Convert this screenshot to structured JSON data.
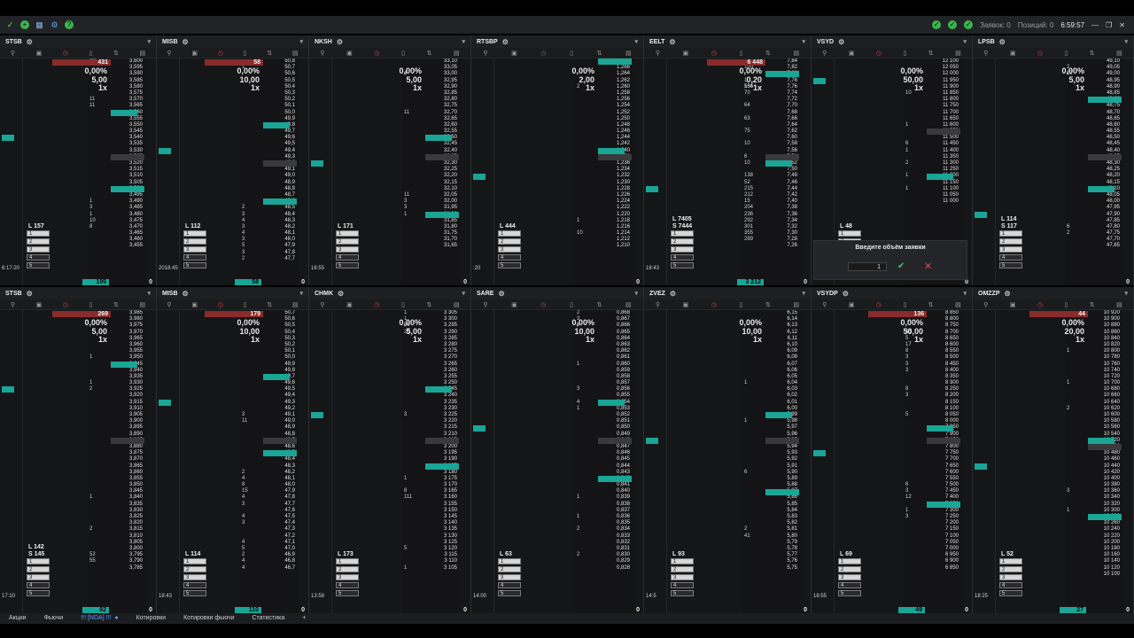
{
  "app": {
    "time": "6:59:57",
    "status_orders": "Заявок: 0",
    "status_positions": "Позиций: 0"
  },
  "popup": {
    "title": "Введите объём заявки",
    "value": "1"
  },
  "statusbar": {
    "tabs": [
      "Акции",
      "Фьючи",
      "!!! [NDA] !!!",
      "Котировки",
      "Котировки фьючи",
      "Статистика"
    ],
    "active_index": 2,
    "add_label": "+"
  },
  "panels_top": [
    {
      "ticker": "STSB",
      "badge": "431",
      "pct": "0,00%",
      "step": "5,00",
      "mult": "1x",
      "l": "L 157",
      "s": "",
      "bot": "195",
      "prices": [
        "3,600",
        "3,595",
        "3,590",
        "3,585",
        "3,580",
        "3,575",
        "3,570",
        "3,565",
        "3,560",
        "3,555",
        "3,550",
        "3,545",
        "3,540",
        "3,535",
        "3,530",
        "3,525",
        "3,520",
        "3,515",
        "3,510",
        "3,505",
        "3,500",
        "3,495",
        "3,490",
        "3,485",
        "3,480",
        "3,475",
        "3,470",
        "3,465",
        "3,460",
        "3,455"
      ],
      "vols": [
        "23",
        "",
        "",
        "",
        "",
        "",
        "11",
        "11",
        "",
        "",
        "",
        "",
        "",
        "",
        "",
        "",
        "",
        "",
        "",
        "",
        "",
        "",
        "1",
        "3",
        "1",
        "10",
        "8",
        "",
        "",
        ""
      ],
      "time": "6:17:20"
    },
    {
      "ticker": "MISB",
      "badge": "58",
      "pct": "0,00%",
      "step": "10,00",
      "mult": "1x",
      "l": "L 112",
      "s": "",
      "bot": "58",
      "prices": [
        "50,8",
        "50,7",
        "50,6",
        "50,5",
        "50,4",
        "50,3",
        "50,2",
        "50,1",
        "50,0",
        "49,9",
        "49,8",
        "49,7",
        "49,6",
        "49,5",
        "49,4",
        "49,3",
        "49,2",
        "49,1",
        "49,0",
        "48,9",
        "48,8",
        "48,7",
        "48,6",
        "48,5",
        "48,4",
        "48,3",
        "48,2",
        "48,1",
        "48,0",
        "47,9",
        "47,8",
        "47,7"
      ],
      "vols": [
        "",
        "1",
        "",
        "",
        "",
        "",
        "",
        "",
        "",
        "",
        "",
        "",
        "",
        "",
        "",
        "",
        "",
        "",
        "",
        "",
        "",
        "",
        "",
        "2",
        "3",
        "4",
        "3",
        "4",
        "3",
        "5",
        "3",
        "2"
      ],
      "time": "2018:45"
    },
    {
      "ticker": "NKSH",
      "badge": "",
      "pct": "0,00%",
      "step": "5,00",
      "mult": "1x",
      "l": "L 171",
      "s": "",
      "bot": "",
      "prices": [
        "33,10",
        "33,05",
        "33,00",
        "32,95",
        "32,90",
        "32,85",
        "32,80",
        "32,75",
        "32,70",
        "32,65",
        "32,60",
        "32,55",
        "32,50",
        "32,45",
        "32,40",
        "32,35",
        "32,30",
        "32,25",
        "32,20",
        "32,15",
        "32,10",
        "32,05",
        "32,00",
        "31,95",
        "31,90",
        "31,85",
        "31,80",
        "31,75",
        "31,70",
        "31,65"
      ],
      "vols": [
        "",
        "",
        "4",
        "",
        "",
        "",
        "",
        "",
        "11",
        "",
        "",
        "",
        "",
        "",
        "",
        "",
        "",
        "",
        "",
        "",
        "",
        "11",
        "3",
        "3",
        "1",
        "",
        "",
        "",
        "",
        ""
      ],
      "time": "18:55"
    },
    {
      "ticker": "RTSBP",
      "badge": "",
      "pct": "0,00%",
      "step": "2,00",
      "mult": "1x",
      "l": "L 444",
      "s": "",
      "bot": "",
      "prices": [
        "1,268",
        "1,266",
        "1,264",
        "1,262",
        "1,260",
        "1,258",
        "1,256",
        "1,254",
        "1,252",
        "1,250",
        "1,248",
        "1,246",
        "1,244",
        "1,242",
        "1,240",
        "1,238",
        "1,236",
        "1,234",
        "1,232",
        "1,230",
        "1,228",
        "1,226",
        "1,224",
        "1,222",
        "1,220",
        "1,218",
        "1,216",
        "1,214",
        "1,212",
        "1,210"
      ],
      "vols": [
        "",
        "",
        "",
        "",
        "2",
        "",
        "",
        "",
        "",
        "",
        "",
        "",
        "",
        "",
        "",
        "",
        "",
        "",
        "",
        "",
        "",
        "",
        "",
        "",
        "",
        "1",
        "",
        "10",
        "",
        ""
      ],
      "time": ":20"
    },
    {
      "ticker": "EELT",
      "badge": "6 448",
      "pct": "0,00%",
      "step": "0,20",
      "mult": "1x",
      "l": "L 7405",
      "s": "S 7444",
      "bot": "3 212",
      "prices": [
        "7,84",
        "7,82",
        "7,80",
        "7,78",
        "7,76",
        "7,74",
        "7,72",
        "7,70",
        "7,68",
        "7,66",
        "7,64",
        "7,62",
        "7,60",
        "7,58",
        "7,56",
        "7,54",
        "7,52",
        "7,50",
        "7,48",
        "7,46",
        "7,44",
        "7,42",
        "7,40",
        "7,38",
        "7,36",
        "7,34",
        "7,32",
        "7,30",
        "7,28",
        "7,26"
      ],
      "vols": [
        "",
        "100",
        "",
        "1 554",
        "136",
        "70",
        "",
        "64",
        "",
        "63",
        "",
        "75",
        "",
        "10",
        "",
        "6",
        "10",
        "",
        "138",
        "52",
        "215",
        "212",
        "15",
        "204",
        "236",
        "292",
        "301",
        "355",
        "289",
        ""
      ],
      "time": "18:43"
    },
    {
      "ticker": "VSYD",
      "badge": "",
      "pct": "0,00%",
      "step": "50,00",
      "mult": "1x",
      "l": "L 48",
      "s": "",
      "bot": "",
      "prices": [
        "12 100",
        "12 050",
        "12 000",
        "11 950",
        "11 900",
        "11 850",
        "11 800",
        "11 750",
        "11 700",
        "11 650",
        "11 600",
        "11 550",
        "11 500",
        "11 450",
        "11 400",
        "11 350",
        "11 300",
        "11 250",
        "11 200",
        "11 150",
        "11 100",
        "11 050",
        "11 000"
      ],
      "vols": [
        "",
        "",
        "",
        "",
        "",
        "10",
        "",
        "",
        "",
        "",
        "1",
        "",
        "",
        "6",
        "1",
        "",
        "2",
        "",
        "1",
        "",
        "1",
        "",
        ""
      ],
      "time": ""
    },
    {
      "ticker": "LPSB",
      "badge": "",
      "pct": "0,00%",
      "step": "5,00",
      "mult": "1x",
      "l": "L 114",
      "s": "S 117",
      "bot": "",
      "prices": [
        "49,10",
        "49,05",
        "49,00",
        "48,95",
        "48,90",
        "48,85",
        "48,80",
        "48,75",
        "48,70",
        "48,65",
        "48,60",
        "48,55",
        "48,50",
        "48,45",
        "48,40",
        "48,35",
        "48,30",
        "48,25",
        "48,20",
        "48,15",
        "48,10",
        "48,05",
        "48,00",
        "47,95",
        "47,90",
        "47,85",
        "47,80",
        "47,75",
        "47,70",
        "47,65"
      ],
      "vols": [
        "",
        "2",
        "12",
        "",
        "",
        "",
        "",
        "",
        "",
        "",
        "",
        "",
        "",
        "",
        "",
        "",
        "",
        "",
        "",
        "",
        "",
        "",
        "",
        "",
        "",
        "",
        "6",
        "2",
        "",
        ""
      ],
      "time": ""
    }
  ],
  "panels_bottom": [
    {
      "ticker": "STSB",
      "badge": "269",
      "pct": "0,00%",
      "step": "5,00",
      "mult": "1x",
      "l": "L 142",
      "s": "S 145",
      "bot": "82",
      "prices": [
        "3,985",
        "3,980",
        "3,975",
        "3,970",
        "3,965",
        "3,960",
        "3,955",
        "3,950",
        "3,945",
        "3,940",
        "3,935",
        "3,930",
        "3,925",
        "3,920",
        "3,915",
        "3,910",
        "3,905",
        "3,900",
        "3,895",
        "3,890",
        "3,885",
        "3,880",
        "3,875",
        "3,870",
        "3,865",
        "3,860",
        "3,855",
        "3,850",
        "3,845",
        "3,840",
        "3,835",
        "3,830",
        "3,825",
        "3,820",
        "3,815",
        "3,810",
        "3,805",
        "3,800",
        "3,795",
        "3,790",
        "3,785"
      ],
      "vols": [
        "",
        "",
        "",
        "",
        "",
        "",
        "",
        "1",
        "",
        "",
        "",
        "1",
        "2",
        "",
        "",
        "",
        "",
        "",
        "",
        "",
        "",
        "",
        "",
        "",
        "",
        "",
        "",
        "",
        "",
        "1",
        "",
        "",
        "",
        "",
        "2",
        "",
        "",
        "",
        "52",
        "55",
        ""
      ],
      "time": "17:10"
    },
    {
      "ticker": "MISB",
      "badge": "179",
      "pct": "0,00%",
      "step": "10,00",
      "mult": "1x",
      "l": "L 114",
      "s": "",
      "bot": "110",
      "prices": [
        "50,7",
        "50,6",
        "50,5",
        "50,4",
        "50,3",
        "50,2",
        "50,1",
        "50,0",
        "49,9",
        "49,8",
        "49,7",
        "49,6",
        "49,5",
        "49,4",
        "49,3",
        "49,2",
        "49,1",
        "49,0",
        "48,9",
        "48,8",
        "48,7",
        "48,6",
        "48,5",
        "48,4",
        "48,3",
        "48,2",
        "48,1",
        "48,0",
        "47,9",
        "47,8",
        "47,7",
        "47,6",
        "47,5",
        "47,4",
        "47,3",
        "47,2",
        "47,1",
        "47,0",
        "46,9",
        "46,8",
        "46,7"
      ],
      "vols": [
        "",
        "",
        "",
        "",
        "",
        "",
        "",
        "",
        "",
        "",
        "",
        "",
        "",
        "",
        "",
        "",
        "3",
        "11",
        "",
        "",
        "",
        "",
        "",
        "",
        "",
        "2",
        "4",
        "8",
        "15",
        "4",
        "3",
        "",
        "4",
        "3",
        "",
        "",
        "4",
        "5",
        "2",
        "4",
        "4"
      ],
      "time": "18:43"
    },
    {
      "ticker": "CHMK",
      "badge": "",
      "pct": "0,00%",
      "step": "5,00",
      "mult": "1x",
      "l": "L 173",
      "s": "",
      "bot": "",
      "prices": [
        "3 305",
        "3 300",
        "3 295",
        "3 290",
        "3 285",
        "3 280",
        "3 275",
        "3 270",
        "3 265",
        "3 260",
        "3 255",
        "3 250",
        "3 245",
        "3 240",
        "3 235",
        "3 230",
        "3 225",
        "3 220",
        "3 215",
        "3 210",
        "3 205",
        "3 200",
        "3 195",
        "3 190",
        "3 185",
        "3 180",
        "3 175",
        "3 170",
        "3 165",
        "3 160",
        "3 155",
        "3 150",
        "3 145",
        "3 140",
        "3 135",
        "3 130",
        "3 125",
        "3 120",
        "3 115",
        "3 110",
        "3 105"
      ],
      "vols": [
        "1",
        "1",
        "30",
        "20",
        "",
        "",
        "",
        "",
        "",
        "",
        "",
        "",
        "",
        "",
        "",
        "",
        "3",
        "",
        "",
        "",
        "",
        "",
        "",
        "",
        "",
        "",
        "1",
        "",
        "8",
        "111",
        "",
        "",
        "",
        "",
        "",
        "",
        "",
        "5",
        "",
        "",
        "1"
      ],
      "time": "13:58"
    },
    {
      "ticker": "SARE",
      "badge": "",
      "pct": "0,00%",
      "step": "10,00",
      "mult": "1x",
      "l": "L 63",
      "s": "",
      "bot": "",
      "prices": [
        "0,868",
        "0,867",
        "0,866",
        "0,865",
        "0,864",
        "0,863",
        "0,862",
        "0,861",
        "0,860",
        "0,859",
        "0,858",
        "0,857",
        "0,856",
        "0,855",
        "0,854",
        "0,853",
        "0,852",
        "0,851",
        "0,850",
        "0,849",
        "0,848",
        "0,847",
        "0,846",
        "0,845",
        "0,844",
        "0,843",
        "0,842",
        "0,841",
        "0,840",
        "0,839",
        "0,838",
        "0,837",
        "0,836",
        "0,835",
        "0,834",
        "0,833",
        "0,832",
        "0,831",
        "0,830",
        "0,829",
        "0,828"
      ],
      "vols": [
        "2",
        "3",
        "6",
        "",
        "",
        "",
        "",
        "",
        "1",
        "",
        "",
        "",
        "3",
        "",
        "4",
        "1",
        "",
        "",
        "",
        "",
        "",
        "",
        "",
        "",
        "",
        "",
        "",
        "",
        "",
        "1",
        "",
        "",
        "1",
        "",
        "2",
        "",
        "",
        "",
        "2",
        "",
        ""
      ],
      "time": "14:00"
    },
    {
      "ticker": "ZVEZ",
      "badge": "",
      "pct": "0,00%",
      "step": "10,00",
      "mult": "1x",
      "l": "L 93",
      "s": "",
      "bot": "",
      "prices": [
        "6,15",
        "6,14",
        "6,13",
        "6,12",
        "6,11",
        "6,10",
        "6,09",
        "6,08",
        "6,07",
        "6,06",
        "6,05",
        "6,04",
        "6,03",
        "6,02",
        "6,01",
        "6,00",
        "5,99",
        "5,98",
        "5,97",
        "5,96",
        "5,95",
        "5,94",
        "5,93",
        "5,92",
        "5,91",
        "5,90",
        "5,89",
        "5,88",
        "5,87",
        "5,86",
        "5,85",
        "5,84",
        "5,83",
        "5,82",
        "5,81",
        "5,80",
        "5,79",
        "5,78",
        "5,77",
        "5,76",
        "5,75"
      ],
      "vols": [
        "",
        "",
        "",
        "",
        "",
        "",
        "",
        "",
        "",
        "",
        "",
        "1",
        "",
        "",
        "",
        "",
        "",
        "1",
        "",
        "",
        "",
        "",
        "",
        "",
        "",
        "6",
        "",
        "",
        "",
        "",
        "",
        "",
        "",
        "",
        "2",
        "41",
        "",
        "",
        "",
        "",
        ""
      ],
      "time": "14:5"
    },
    {
      "ticker": "VSYDP",
      "badge": "136",
      "pct": "0,00%",
      "step": "50,00",
      "mult": "1x",
      "l": "L 69",
      "s": "",
      "bot": "49",
      "prices": [
        "8 850",
        "8 800",
        "8 750",
        "8 700",
        "8 650",
        "8 600",
        "8 550",
        "8 500",
        "8 450",
        "8 400",
        "8 350",
        "8 300",
        "8 250",
        "8 200",
        "8 150",
        "8 100",
        "8 050",
        "8 000",
        "7 950",
        "7 900",
        "7 850",
        "7 800",
        "7 750",
        "7 700",
        "7 650",
        "7 600",
        "7 550",
        "7 500",
        "7 450",
        "7 400",
        "7 350",
        "7 300",
        "7 250",
        "7 200",
        "7 150",
        "7 100",
        "7 050",
        "7 000",
        "6 950",
        "6 900",
        "6 850"
      ],
      "vols": [
        "",
        "",
        "",
        "61",
        "5",
        "17",
        "8",
        "3",
        "3",
        "3",
        "",
        "",
        "8",
        "3",
        "",
        "",
        "5",
        "",
        "",
        "",
        "",
        "",
        "",
        "",
        "",
        "",
        "",
        "6",
        "3",
        "12",
        "",
        "1",
        "3",
        "",
        "",
        "",
        "",
        "",
        "",
        "",
        ""
      ],
      "time": "18:55"
    },
    {
      "ticker": "OMZZP",
      "badge": "44",
      "pct": "0,00%",
      "step": "20,00",
      "mult": "1x",
      "l": "L 52",
      "s": "",
      "bot": "27",
      "prices": [
        "10 920",
        "10 900",
        "10 880",
        "10 860",
        "10 840",
        "10 820",
        "10 800",
        "10 780",
        "10 760",
        "10 740",
        "10 720",
        "10 700",
        "10 680",
        "10 660",
        "10 640",
        "10 620",
        "10 600",
        "10 580",
        "10 560",
        "10 540",
        "10 520",
        "10 500",
        "10 480",
        "10 460",
        "10 440",
        "10 420",
        "10 400",
        "10 380",
        "10 360",
        "10 340",
        "10 320",
        "10 300",
        "10 280",
        "10 260",
        "10 240",
        "10 220",
        "10 200",
        "10 180",
        "10 160",
        "10 140",
        "10 120",
        "10 100"
      ],
      "vols": [
        "",
        "",
        "",
        "",
        "",
        "",
        "1",
        "",
        "",
        "",
        "",
        "1",
        "",
        "",
        "",
        "2",
        "",
        "",
        "",
        "",
        "",
        "",
        "",
        "",
        "",
        "",
        "",
        "",
        "3",
        "",
        "",
        "1",
        "",
        "",
        "",
        "",
        "",
        "",
        "",
        "",
        "",
        ""
      ],
      "time": "18:25"
    }
  ]
}
